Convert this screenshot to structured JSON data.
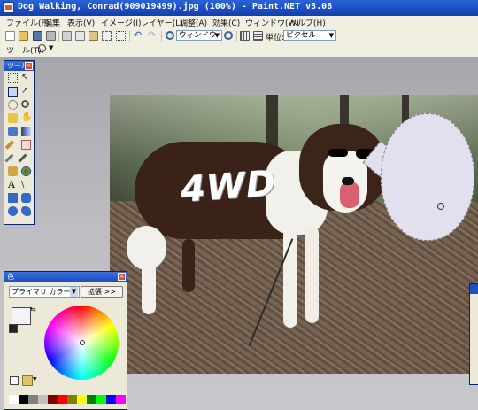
{
  "window": {
    "title": "Dog Walking, Conrad(909019499).jpg (100%) - Paint.NET v3.08"
  },
  "menu": [
    "ファイル(F)",
    "編集",
    "表示(V)",
    "イメージ(I)",
    "レイヤー(L)",
    "調整(A)",
    "効果(C)",
    "ウィンドウ(W)",
    "ヘルプ(H)"
  ],
  "toolbar": {
    "zoom_value": "ウィンドウ",
    "units_label": "単位:",
    "units_value": "ピクセル"
  },
  "toolbar2": {
    "tool_label": "ツール(T):"
  },
  "tools_panel": {
    "title": "ツール"
  },
  "colors_panel": {
    "title": "色",
    "mode_value": "プライマリ カラー",
    "expand_label": "拡張 >>"
  },
  "canvas": {
    "overlay_text": "4WD"
  },
  "colors": {
    "accent_blue": "#1b4fc4",
    "primary_color": "#f4f4f8",
    "secondary_color": "#9b7fb8",
    "palette": [
      "#ffffff",
      "#000000",
      "#808080",
      "#c0c0c0",
      "#800000",
      "#ff0000",
      "#808000",
      "#ffff00",
      "#008000",
      "#00ff00",
      "#008080",
      "#00ffff",
      "#000080",
      "#0000ff",
      "#800080",
      "#ff00ff",
      "#ff8040",
      "#ffc080",
      "#80ff80",
      "#80c0ff"
    ]
  }
}
